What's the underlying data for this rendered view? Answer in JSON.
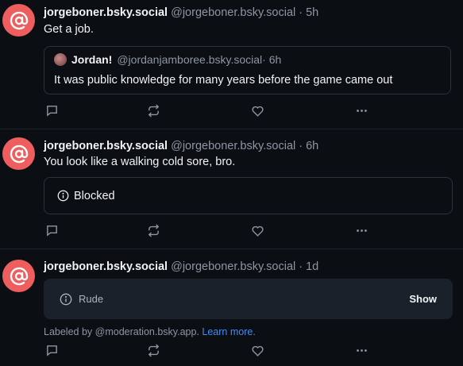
{
  "posts": [
    {
      "display_name": "jorgeboner.bsky.social",
      "handle": "@jorgeboner.bsky.social",
      "time": " · 5h",
      "text": "Get a job.",
      "quote": {
        "display_name": "Jordan!",
        "handle": "@jordanjamboree.bsky.social",
        "time": " · 6h",
        "text": "It was public knowledge for many years before the game came out"
      }
    },
    {
      "display_name": "jorgeboner.bsky.social",
      "handle": "@jorgeboner.bsky.social",
      "time": " · 6h",
      "text": "You look like a walking cold sore, bro.",
      "blocked_label": "Blocked"
    },
    {
      "display_name": "jorgeboner.bsky.social",
      "handle": "@jorgeboner.bsky.social",
      "time": " · 1d",
      "moderation": {
        "label": "Rude",
        "show_label": "Show",
        "labeled_by_prefix": "Labeled by @moderation.bsky.app. ",
        "learn_more": "Learn more."
      }
    }
  ],
  "icons": {
    "avatar": "at-sign-icon",
    "reply": "reply-icon",
    "repost": "repost-icon",
    "like": "heart-icon",
    "more": "more-icon",
    "info": "info-icon"
  },
  "colors": {
    "background": "#0b0e13",
    "avatar": "#ee5e5e",
    "link": "#3f8ef5",
    "muted": "#8c96a3"
  }
}
